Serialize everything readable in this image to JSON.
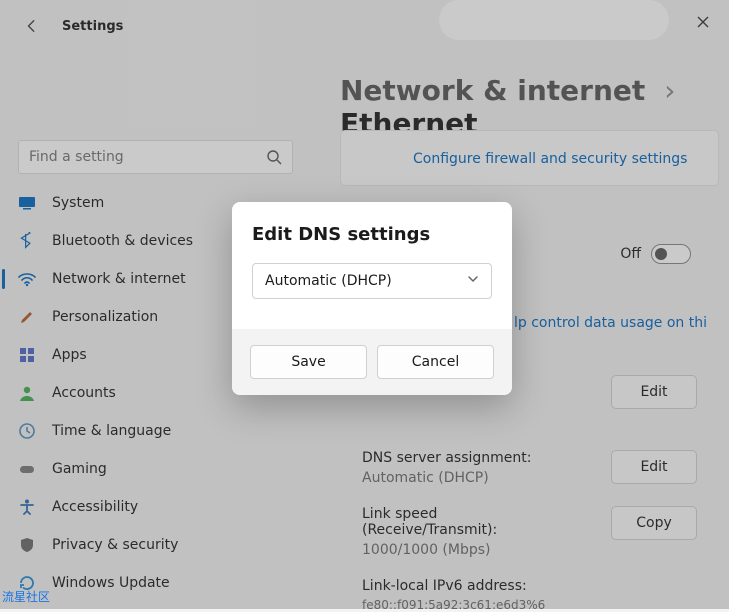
{
  "titlebar": {
    "title": "Settings"
  },
  "breadcrumb": {
    "parent": "Network & internet",
    "sep": "›",
    "current": "Ethernet"
  },
  "search": {
    "placeholder": "Find a setting"
  },
  "sidebar": {
    "items": [
      {
        "label": "System",
        "icon": "monitor-icon",
        "color": "#0067c0"
      },
      {
        "label": "Bluetooth & devices",
        "icon": "bluetooth-icon",
        "color": "#0067c0"
      },
      {
        "label": "Network & internet",
        "icon": "wifi-icon",
        "color": "#0067c0",
        "active": true
      },
      {
        "label": "Personalization",
        "icon": "brush-icon",
        "color": "#b05c24"
      },
      {
        "label": "Apps",
        "icon": "apps-icon",
        "color": "#4f67c8"
      },
      {
        "label": "Accounts",
        "icon": "person-icon",
        "color": "#3aaf4e"
      },
      {
        "label": "Time & language",
        "icon": "clock-icon",
        "color": "#4e8fbd"
      },
      {
        "label": "Gaming",
        "icon": "gaming-icon",
        "color": "#7a7a7a"
      },
      {
        "label": "Accessibility",
        "icon": "accessibility-icon",
        "color": "#2a6fb5"
      },
      {
        "label": "Privacy & security",
        "icon": "shield-icon",
        "color": "#6a6a6a"
      },
      {
        "label": "Windows Update",
        "icon": "update-icon",
        "color": "#1f8bd6"
      }
    ]
  },
  "main": {
    "firewall_link": "Configure firewall and security settings",
    "metered": {
      "state_label": "Off"
    },
    "data_usage_link": "lp control data usage on thi",
    "edit_button": "Edit",
    "copy_button": "Copy",
    "rows": {
      "dns_label": "DNS server assignment:",
      "dns_value": "Automatic (DHCP)",
      "linkspeed_label": "Link speed (Receive/Transmit):",
      "linkspeed_value": "1000/1000 (Mbps)",
      "ipv6_label": "Link-local IPv6 address:",
      "ipv6_value": "fe80::f091:5a92:3c61:e6d3%6"
    }
  },
  "modal": {
    "title": "Edit DNS settings",
    "select_value": "Automatic (DHCP)",
    "save": "Save",
    "cancel": "Cancel"
  },
  "watermark": "流星社区"
}
